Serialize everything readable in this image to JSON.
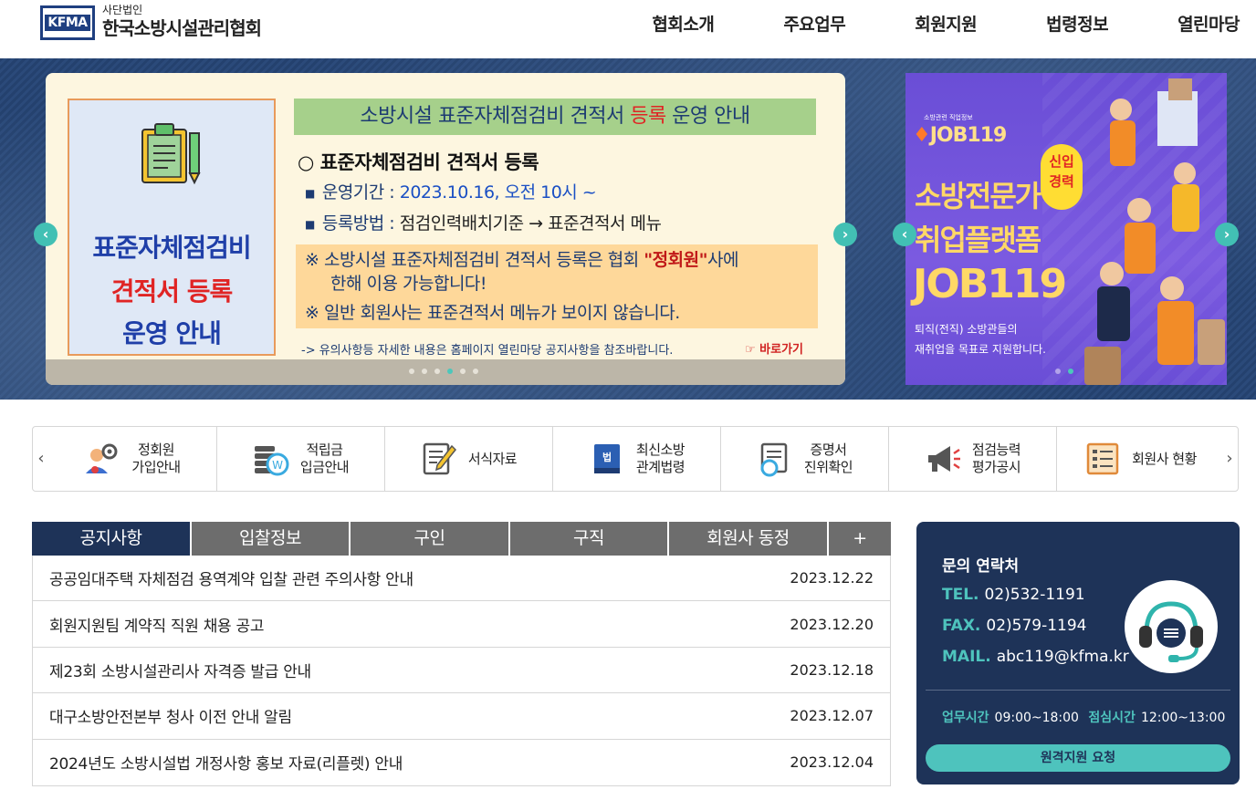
{
  "header": {
    "logo_badge": "KFMA",
    "logo_sub": "사단법인",
    "logo_main": "한국소방시설관리협회",
    "nav": [
      "협회소개",
      "주요업무",
      "회원지원",
      "법령정보",
      "열린마당"
    ]
  },
  "slider": {
    "left_line1": "표준자체점검비",
    "left_line2": "견적서 등록",
    "left_line3": "운영 안내",
    "title_a": "소방시설 표준자체점검비 견적서 ",
    "title_b": "등록",
    "title_c": " 운영 안내",
    "heading": "○ 표준자체점검비 견적서 등록",
    "line1_label": "운영기간 : ",
    "line1_value": "2023.10.16, 오전 10시 ~",
    "line2_label": "등록방법 : ",
    "line2_value": "점검인력배치기준 → 표준견적서 메뉴",
    "note1_a": "※ 소방시설 표준자체점검비 견적서 등록은 협회 ",
    "note1_b": "\"정회원\"",
    "note1_c": "사에",
    "note2": "한해 이용 가능합니다!",
    "note3": "※ 일반 회원사는 표준견적서 메뉴가 보이지 않습니다.",
    "footnote": "-> 유의사항등 자세한 내용은 홈페이지 열린마당 공지사항을 참조바랍니다.",
    "link": "☞ 바로가기",
    "dot_count": 6,
    "active_dot": 3,
    "arrow_prev": "‹",
    "arrow_next": "›"
  },
  "side_banner": {
    "small": "소방관련 직업정보",
    "job_logo": "JOB119",
    "badge": "신입\n경력",
    "headline1": "소방전문가",
    "headline2": "취업플랫폼",
    "headline3": "JOB119",
    "desc1": "퇴직(전직) 소방관들의",
    "desc2": "재취업을 목표로 지원합니다.",
    "active_dot": 1
  },
  "quick_menu": [
    {
      "label": "정회원\n가입안내",
      "icon": "user-gear-icon"
    },
    {
      "label": "적립금\n입금안내",
      "icon": "coin-stack-icon"
    },
    {
      "label": "서식자료",
      "icon": "form-pencil-icon"
    },
    {
      "label": "최신소방\n관계법령",
      "icon": "law-book-icon"
    },
    {
      "label": "증명서\n진위확인",
      "icon": "certificate-check-icon"
    },
    {
      "label": "점검능력\n평가공시",
      "icon": "megaphone-icon"
    },
    {
      "label": "회원사 현황",
      "icon": "list-board-icon"
    }
  ],
  "board": {
    "tabs": [
      "공지사항",
      "입찰정보",
      "구인",
      "구직",
      "회원사 동정",
      "+"
    ],
    "active_tab": 0,
    "rows": [
      {
        "title": "공공임대주택 자체점검 용역계약 입찰 관련 주의사항 안내",
        "date": "2023.12.22"
      },
      {
        "title": "회원지원팀 계약직 직원 채용 공고",
        "date": "2023.12.20"
      },
      {
        "title": "제23회 소방시설관리사 자격증 발급 안내",
        "date": "2023.12.18"
      },
      {
        "title": "대구소방안전본부 청사 이전 안내 알림",
        "date": "2023.12.07"
      },
      {
        "title": "2024년도 소방시설법 개정사항 홍보 자료(리플렛) 안내",
        "date": "2023.12.04"
      }
    ]
  },
  "contact": {
    "title": "문의 연락처",
    "tel_label": "TEL.",
    "tel": "02)532-1191",
    "fax_label": "FAX.",
    "fax": "02)579-1194",
    "mail_label": "MAIL.",
    "mail": "abc119@kfma.kr",
    "hours_label": "업무시간",
    "hours": "09:00~18:00",
    "lunch_label": "점심시간",
    "lunch": "12:00~13:00",
    "button": "원격지원 요청"
  },
  "colors": {
    "navy": "#1e3358",
    "teal": "#4ec3bd",
    "tab_gray": "#6d6d6d"
  }
}
